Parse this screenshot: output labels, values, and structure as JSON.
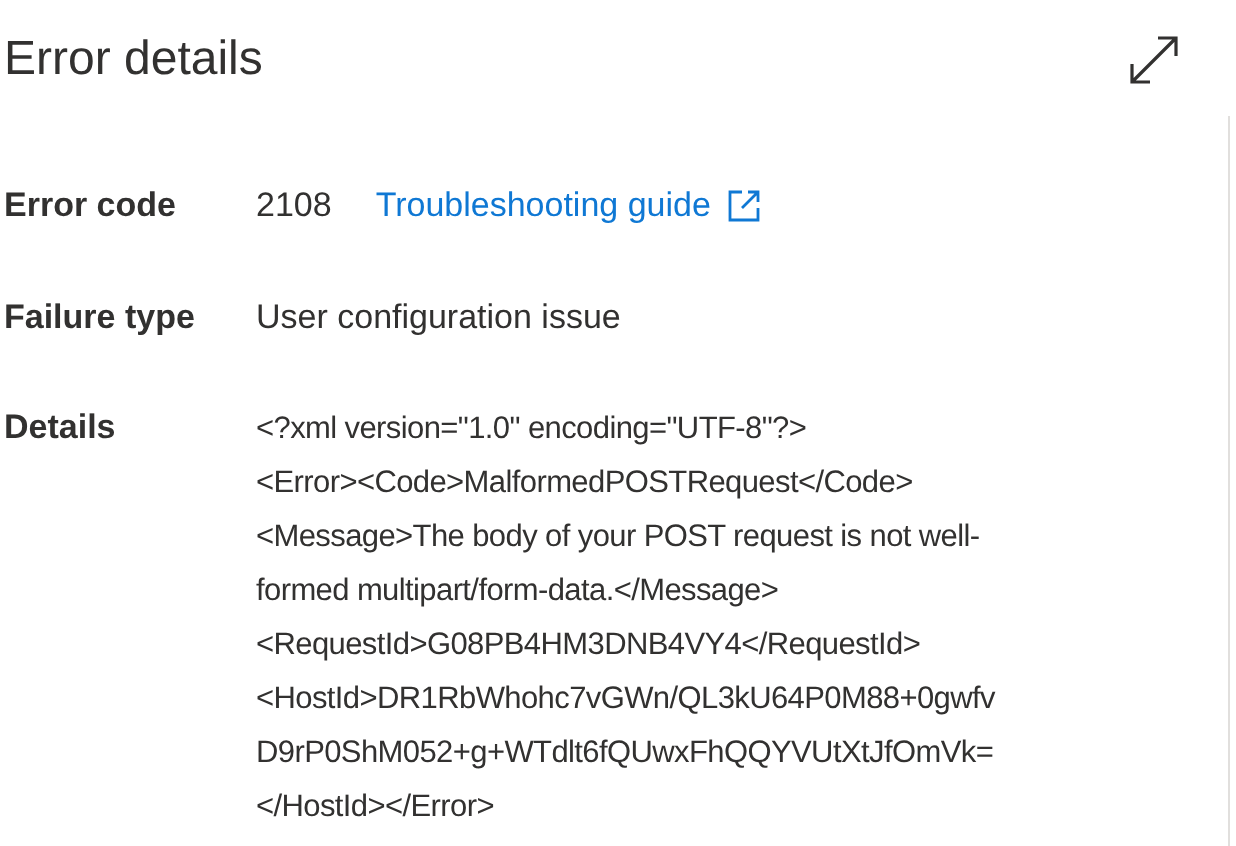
{
  "title": "Error details",
  "fields": [
    {
      "kind": "code",
      "label": "Error code",
      "value": "2108",
      "link": "Troubleshooting guide"
    },
    {
      "kind": "text",
      "label": "Failure type",
      "value": "User configuration issue"
    },
    {
      "kind": "lines",
      "label": "Details",
      "lines": [
        "<?xml version=\"1.0\" encoding=\"UTF-8\"?>",
        "<Error><Code>MalformedPOSTRequest</Code>",
        "<Message>The body of your POST request is not well-",
        "formed multipart/form-data.</Message>",
        "<RequestId>G08PB4HM3DNB4VY4</RequestId>",
        "<HostId>DR1RbWhohc7vGWn/QL3kU64P0M88+0gwfv",
        "D9rP0ShM052+g+WTdlt6fQUwxFhQQYVUtXtJfOmVk=",
        "</HostId></Error>"
      ]
    }
  ]
}
